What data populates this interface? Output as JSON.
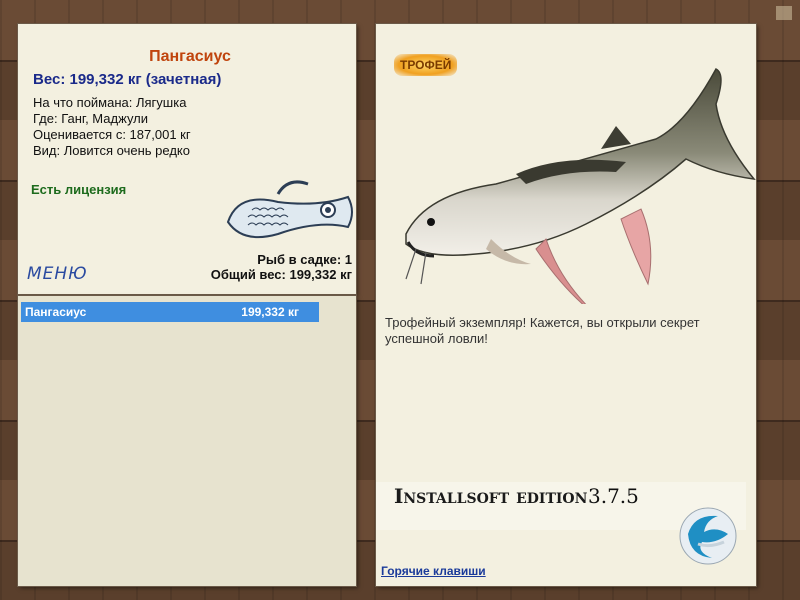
{
  "fish": {
    "name": "Пангасиус",
    "weight_line": "Вес: 199,332 кг (зачетная)",
    "bait": "На что поймана: Лягушка",
    "location": "Где: Ганг, Маджули",
    "value": "Оценивается с: 187,001 кг",
    "rarity": "Вид: Ловится очень редко"
  },
  "license": "Есть лицензия",
  "menu_label": "МЕНЮ",
  "cage": {
    "count": "Рыб в садке: 1",
    "total": "Общий вес: 199,332 кг"
  },
  "list": [
    {
      "name": "Пангасиус",
      "weight": "199,332 кг"
    }
  ],
  "trophy": {
    "badge": "ТРОФЕЙ",
    "text": "Трофейный экземпляр! Кажется, вы открыли секрет успешной ловли!"
  },
  "brand": {
    "name": "Installsoft edition",
    "version": "3.7.5"
  },
  "hotkeys": "Горячие клавиши",
  "colors": {
    "title": "#c0440d",
    "weight": "#1a2a8a",
    "license": "#1d6b1d",
    "selection": "#3f8ee0",
    "link": "#1a3a9a"
  }
}
